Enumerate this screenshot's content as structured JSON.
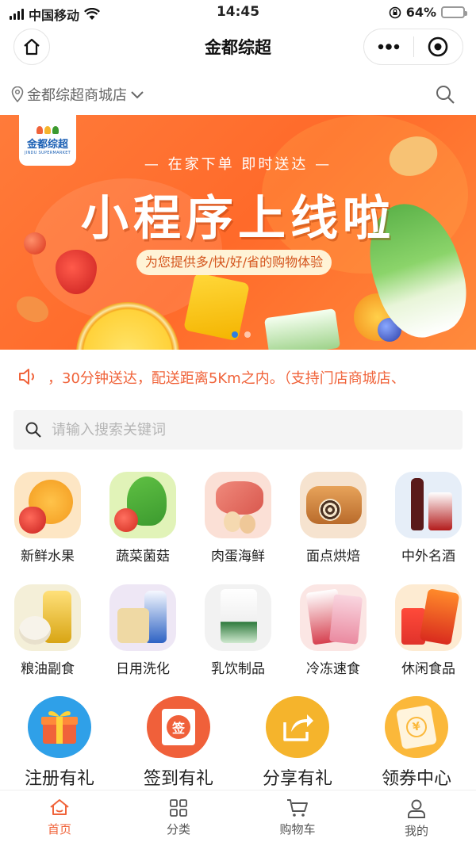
{
  "status_bar": {
    "carrier": "中国移动",
    "time": "14:45",
    "battery": "64%",
    "battery_level": 0.64,
    "battery_color": "#4cd964"
  },
  "navbar": {
    "title": "金都综超",
    "home_icon": "home-icon",
    "more_icon": "more-dots-icon",
    "close_icon": "target-circle-icon"
  },
  "store": {
    "name": "金都综超商城店",
    "location_icon": "location-pin-icon",
    "dropdown_icon": "chevron-down-icon",
    "search_icon": "search-icon"
  },
  "banner": {
    "logo_text": "金都综超",
    "logo_sub": "JINDU SUPERMARKET",
    "tagline": "— 在家下单  即时送达 —",
    "headline": "小程序上线啦",
    "subtitle": "为您提供多/快/好/省的购物体验",
    "slide_count": 2,
    "active_slide": 1,
    "colors": {
      "primary": "#ff6a2a",
      "dot_active": "#2f7de1",
      "dot_inactive": "#ffffff"
    }
  },
  "notice": {
    "icon": "speaker-icon",
    "text": "，30分钟送达，配送距离5Km之内。（支持门店商城店、"
  },
  "search": {
    "placeholder": "请输入搜索关键词",
    "value": ""
  },
  "categories": [
    {
      "label": "新鲜水果",
      "icon": "fruit-icon",
      "bg": "#fde6c4",
      "accent": "#f39a1e"
    },
    {
      "label": "蔬菜菌菇",
      "icon": "vegetable-icon",
      "bg": "#e1f3b8",
      "accent": "#3c9a2f"
    },
    {
      "label": "肉蛋海鲜",
      "icon": "meat-icon",
      "bg": "#fbe0d6",
      "accent": "#d9584e"
    },
    {
      "label": "面点烘焙",
      "icon": "bread-icon",
      "bg": "#f6e3cf",
      "accent": "#b96b2b"
    },
    {
      "label": "中外名酒",
      "icon": "wine-icon",
      "bg": "#e6eef8",
      "accent": "#b31b1b"
    },
    {
      "label": "粮油副食",
      "icon": "grain-oil-icon",
      "bg": "#f4efd8",
      "accent": "#d8a514"
    },
    {
      "label": "日用洗化",
      "icon": "detergent-icon",
      "bg": "#eee7f5",
      "accent": "#2e63c4"
    },
    {
      "label": "乳饮制品",
      "icon": "milk-icon",
      "bg": "#f2f2f2",
      "accent": "#2f7a3d"
    },
    {
      "label": "冷冻速食",
      "icon": "frozen-food-icon",
      "bg": "#fbe6e4",
      "accent": "#d6404f"
    },
    {
      "label": "休闲食品",
      "icon": "snack-icon",
      "bg": "#fdebd2",
      "accent": "#e0332b"
    }
  ],
  "rewards": [
    {
      "label": "注册有礼",
      "icon": "gift-icon",
      "color": "#2fa0e8"
    },
    {
      "label": "签到有礼",
      "icon": "sign-in-icon",
      "color": "#f0603a",
      "badge": "签"
    },
    {
      "label": "分享有礼",
      "icon": "share-icon",
      "color": "#f5b42c"
    },
    {
      "label": "领券中心",
      "icon": "coupon-icon",
      "color": "#fbb83a",
      "badge": "¥"
    }
  ],
  "tabbar": {
    "active_color": "#f0633a",
    "items": [
      {
        "label": "首页",
        "icon": "home-tab-icon",
        "active": true
      },
      {
        "label": "分类",
        "icon": "category-grid-icon",
        "active": false
      },
      {
        "label": "购物车",
        "icon": "cart-icon",
        "active": false
      },
      {
        "label": "我的",
        "icon": "user-icon",
        "active": false
      }
    ]
  }
}
